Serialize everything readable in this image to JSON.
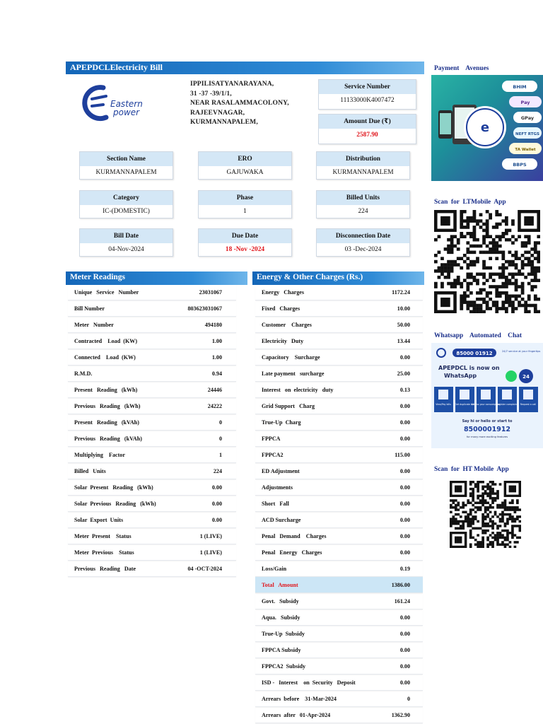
{
  "header": {
    "title": "APEPDCLElectricity  Bill"
  },
  "logo": {
    "line1": "Eastern",
    "line2": "power"
  },
  "consumer": {
    "address_lines": [
      "IPPILISATYANARAYANA,",
      "31 -37 -39/1/1,",
      "NEAR RASALAMMACOLONY,",
      "RAJEEVNAGAR,",
      "KURMANNAPALEM,"
    ]
  },
  "service": {
    "service_number_label": "Service  Number",
    "service_number": "11133000K4007472",
    "amount_due_label": "Amount Due (₹)",
    "amount_due": "2587.90"
  },
  "info_boxes": [
    {
      "label": "Section   Name",
      "value": "KURMANNAPALEM"
    },
    {
      "label": "ERO",
      "value": "GAJUWAKA"
    },
    {
      "label": "Distribution",
      "value": "KURMANNAPALEM"
    },
    {
      "label": "Category",
      "value": "IC-(DOMESTIC)"
    },
    {
      "label": "Phase",
      "value": "1"
    },
    {
      "label": "Billed  Units",
      "value": "224"
    },
    {
      "label": "Bill Date",
      "value": "04-Nov-2024"
    },
    {
      "label": "Due Date",
      "value": "18 -Nov -2024"
    },
    {
      "label": "Disconnection    Date",
      "value": "03 -Dec-2024"
    }
  ],
  "meter_readings": {
    "title": "Meter  Readings",
    "rows": [
      {
        "label": "Unique   Service   Number",
        "value": "23031067"
      },
      {
        "label": "Bill Number",
        "value": "803623031067"
      },
      {
        "label": "Meter   Number",
        "value": "494180"
      },
      {
        "label": "Contracted    Load  (KW)",
        "value": "1.00"
      },
      {
        "label": "Connected    Load  (KW)",
        "value": "1.00"
      },
      {
        "label": "R.M.D.",
        "value": "0.94"
      },
      {
        "label": "Present   Reading   (kWh)",
        "value": "24446"
      },
      {
        "label": "Previous   Reading   (kWh)",
        "value": "24222"
      },
      {
        "label": "Present   Reading   (kVAh)",
        "value": "0"
      },
      {
        "label": "Previous   Reading   (kVAh)",
        "value": "0"
      },
      {
        "label": "Multiplying    Factor",
        "value": "1"
      },
      {
        "label": "Billed   Units",
        "value": "224"
      },
      {
        "label": "Solar  Present   Reading   (kWh)",
        "value": "0.00"
      },
      {
        "label": "Solar  Previous   Reading   (kWh)",
        "value": "0.00"
      },
      {
        "label": "Solar  Export  Units",
        "value": "0.00"
      },
      {
        "label": "Meter  Present    Status",
        "value": "1 (LIVE)"
      },
      {
        "label": "Meter  Previous    Status",
        "value": "1 (LIVE)"
      },
      {
        "label": "Previous   Reading   Date",
        "value": "04 -OCT-2024"
      }
    ]
  },
  "charges": {
    "title": "Energy  &  Other  Charges  (Rs.)",
    "rows": [
      {
        "label": "Energy   Charges",
        "value": "1172.24"
      },
      {
        "label": "Fixed   Charges",
        "value": "10.00"
      },
      {
        "label": "Customer    Charges",
        "value": "50.00"
      },
      {
        "label": "Electricity   Duty",
        "value": "13.44"
      },
      {
        "label": "Capacitory    Surcharge",
        "value": "0.00"
      },
      {
        "label": "Late payment   surcharge",
        "value": "25.00"
      },
      {
        "label": "Interest   on  electricity   duty",
        "value": "0.13"
      },
      {
        "label": "Grid Support   Charg",
        "value": "0.00"
      },
      {
        "label": "True-Up  Charg",
        "value": "0.00"
      },
      {
        "label": "FPPCA",
        "value": "0.00"
      },
      {
        "label": "FPPCA2",
        "value": "115.00"
      },
      {
        "label": "ED Adjustment",
        "value": "0.00"
      },
      {
        "label": "Adjustments",
        "value": "0.00"
      },
      {
        "label": "Short   Fall",
        "value": "0.00"
      },
      {
        "label": "ACD Surcharge",
        "value": "0.00"
      },
      {
        "label": "Penal   Demand    Charges",
        "value": "0.00"
      },
      {
        "label": "Penal   Energy   Charges",
        "value": "0.00"
      },
      {
        "label": "Loss/Gain",
        "value": "0.19"
      },
      {
        "label": "Total   Amount",
        "value": "1386.00",
        "highlight": true
      },
      {
        "label": "Govt.   Subsidy",
        "value": "161.24"
      },
      {
        "label": "Aqua.   Subsidy",
        "value": "0.00"
      },
      {
        "label": "True-Up  Subsidy",
        "value": "0.00"
      },
      {
        "label": "FPPCA Subsidy",
        "value": "0.00"
      },
      {
        "label": "FPPCA2  Subsidy",
        "value": "0.00"
      },
      {
        "label": "ISD -   Interest    on  Security   Deposit",
        "value": "0.00"
      },
      {
        "label": "Arrears  before    31-Mar-2024",
        "value": "0"
      },
      {
        "label": "Arrears  after   01-Apr-2024",
        "value": "1362.90"
      }
    ]
  },
  "sidebar": {
    "payment_label": "Payment    Avenues",
    "lt_app_label": "Scan  for  LTMobile  App",
    "whatsapp_label": "Whatsapp    Automated    Chat",
    "ht_app_label": "Scan  for  HT Mobile  App",
    "payment_chips": [
      "BHIM",
      "Pay",
      "GPay",
      "NEFT RTGS",
      "TA Wallet",
      "BBPS"
    ],
    "whatsapp_banner": {
      "phone_top": "85000 01912",
      "tagline": "24/7 service at your fingertips",
      "headline_1": "APEPDCL is now on",
      "headline_2": "WhatsApp",
      "services": [
        "View/Pay bills",
        "Get duplicate bill",
        "Assess your consumption",
        "Register complaint",
        "Request a call"
      ],
      "say_hi": "Say hi or hello or start to",
      "number": "8500001912",
      "footer": "for many more exciting features"
    }
  },
  "colors": {
    "accent_blue": "#1466b8",
    "header_tint": "#d4e7f6",
    "alert_red": "#e0161c"
  }
}
